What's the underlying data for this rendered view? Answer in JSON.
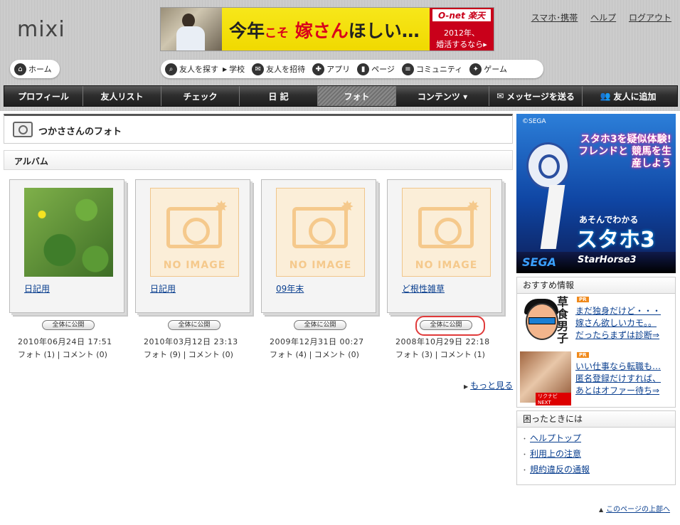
{
  "header": {
    "logo": "mixi",
    "banner": {
      "text_part1": "今年",
      "text_part2": "こそ",
      "text_part3": "嫁さん",
      "text_part4": "ほしい…",
      "brand": "O-net 楽天",
      "sub1": "2012年、",
      "sub2": "婚活するなら▸"
    },
    "top_links": [
      "スマホ･携帯",
      "ヘルプ",
      "ログアウト"
    ],
    "home_label": "ホーム",
    "tools": {
      "search_friends": "友人を探す",
      "school": "学校",
      "invite": "友人を招待",
      "apps": "アプリ",
      "pages": "ページ",
      "community": "コミュニティ",
      "games": "ゲーム"
    }
  },
  "nav": {
    "profile": "プロフィール",
    "friends": "友人リスト",
    "check": "チェック",
    "diary": "日 記",
    "photo": "フォト",
    "contents": "コンテンツ ▾",
    "message": "メッセージを送る",
    "add_friend": "友人に追加"
  },
  "main": {
    "page_title": "つかささんのフォト",
    "album_heading": "アルバム",
    "no_image": "NO IMAGE",
    "albums": [
      {
        "title": "日記用",
        "visibility": "全体に公開",
        "date": "2010年06月24日  17:51",
        "counts": "フォト (1) | コメント (0)"
      },
      {
        "title": "日記用",
        "visibility": "全体に公開",
        "date": "2010年03月12日  23:13",
        "counts": "フォト (9) | コメント (0)"
      },
      {
        "title": "09年末",
        "visibility": "全体に公開",
        "date": "2009年12月31日  00:27",
        "counts": "フォト (4) | コメント (0)"
      },
      {
        "title": "ど根性雑草",
        "visibility": "全体に公開",
        "date": "2008年10月29日  22:18",
        "counts": "フォト (3) | コメント (1)"
      }
    ],
    "more_link": "もっと見る"
  },
  "sidebar": {
    "ad": {
      "copyright": "©SEGA",
      "promo": "スタホ3を疑似体験! フレンドと 競馬を生産しよう",
      "subtitle": "あそんでわかる",
      "title": "スタホ3",
      "sega": "SEGA",
      "product": "StarHorse3"
    },
    "recommend": {
      "heading": "おすすめ情報",
      "pr": "PR",
      "item1_tag": "草食男子",
      "item1": [
        "まだ独身だけど・・・",
        "嫁さん欲しいカモ。。",
        "だったらまずは診断⇒"
      ],
      "item2_tag": "リクナビNEXT",
      "item2": [
        "いい仕事なら転職も…",
        "匿名登録だけすれば、",
        "あとはオファー待ち⇒"
      ]
    },
    "help": {
      "heading": "困ったときには",
      "links": [
        "ヘルプトップ",
        "利用上の注意",
        "規約違反の通報"
      ]
    }
  },
  "footer": {
    "to_top": "このページの上部へ"
  }
}
